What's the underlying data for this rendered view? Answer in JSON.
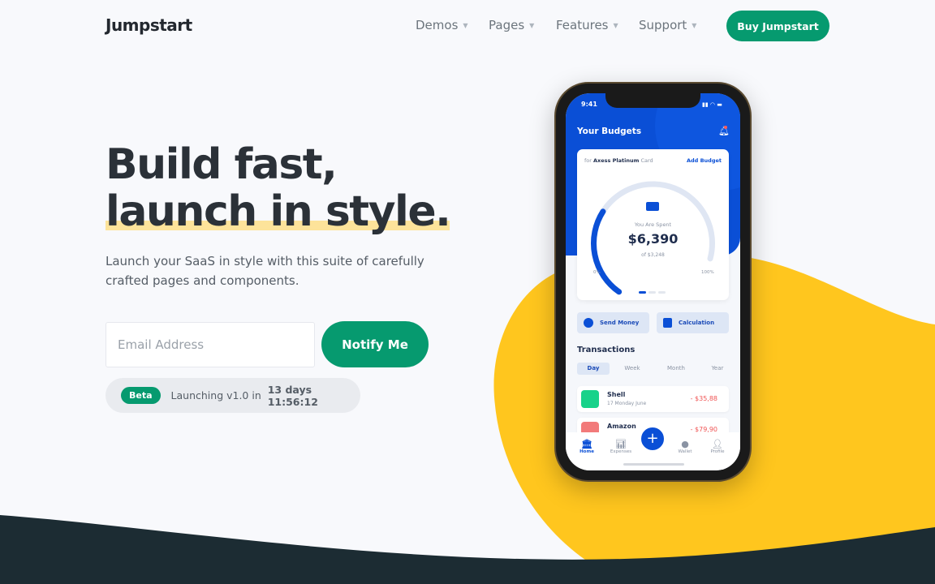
{
  "header": {
    "logo": "Jumpstart",
    "nav": [
      {
        "label": "Demos"
      },
      {
        "label": "Pages"
      },
      {
        "label": "Features"
      },
      {
        "label": "Support"
      }
    ],
    "caret": "▼",
    "cta": "Buy Jumpstart"
  },
  "hero": {
    "title_line1": "Build fast,",
    "title_line2": "launch in style.",
    "lead": "Launch your SaaS in style with this suite of carefully crafted pages and components.",
    "email_placeholder": "Email Address",
    "notify_label": "Notify Me",
    "badge": "Beta",
    "launch_prefix": "Launching v1.0 in ",
    "launch_countdown": "13 days 11:56:12"
  },
  "colors": {
    "brand": "#069a6f",
    "yellow": "#ffc61e",
    "dark": "#1c2c33",
    "phone_blue": "#0a4fd6"
  },
  "phone": {
    "time": "9:41",
    "title": "Your Budgets",
    "card": {
      "for": "for ",
      "card_name": "Axess Platinum",
      "card_suffix": " Card",
      "add": "Add Budget",
      "label": "You Are Spent",
      "amount": "$6,390",
      "of": "of $3,248",
      "min": "0%",
      "max": "100%",
      "progress": 0.35
    },
    "actions": [
      {
        "label": "Send Money",
        "icon": "globe-icon"
      },
      {
        "label": "Calculation",
        "icon": "calculator-icon"
      }
    ],
    "transactions_title": "Transactions",
    "tabs": [
      "Day",
      "Week",
      "Month",
      "Year"
    ],
    "transactions": [
      {
        "name": "Shell",
        "date": "17 Monday June",
        "amount": "- $35,88",
        "icon": "fuel-icon"
      },
      {
        "name": "Amazon",
        "amount": "- $79,90",
        "icon": "cart-icon"
      }
    ],
    "nav": [
      {
        "label": "Home"
      },
      {
        "label": "Expenses"
      },
      {
        "label": "Wallet"
      },
      {
        "label": "Profile"
      }
    ]
  }
}
